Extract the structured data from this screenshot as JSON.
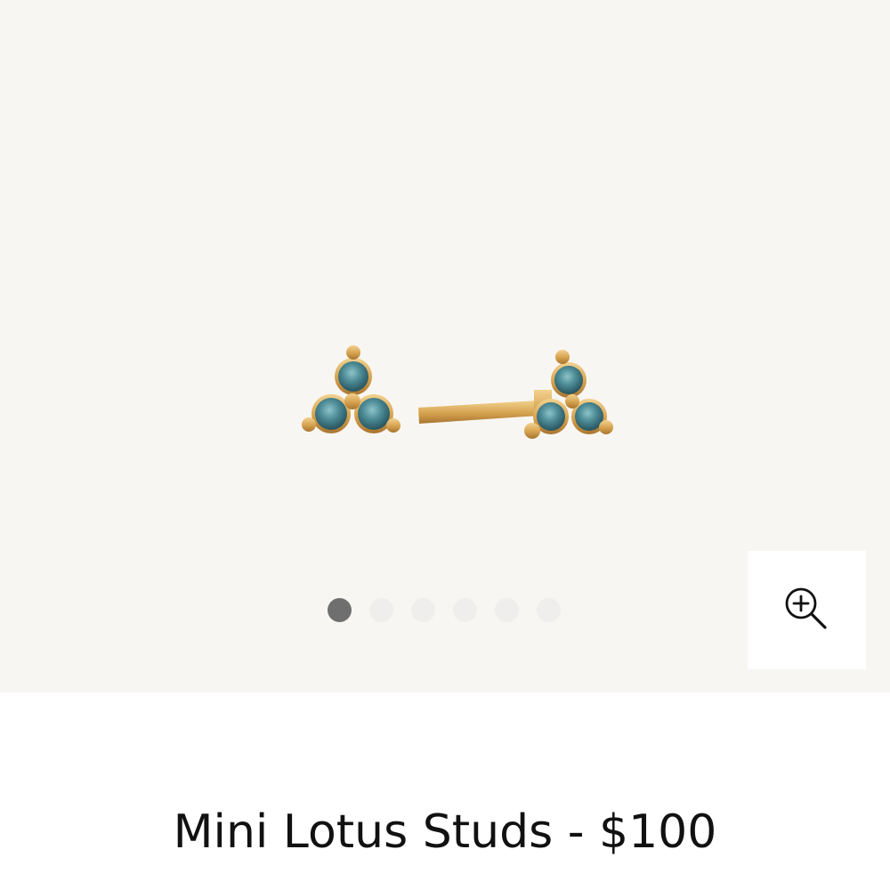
{
  "product": {
    "name": "Mini Lotus Studs",
    "separator": "-",
    "price": "$100",
    "image_alt": "Mini Lotus Studs earrings with blue-green stones on gold setting"
  },
  "gallery": {
    "total_images": 6,
    "active_index": 0,
    "zoom_icon": "zoom-in-icon",
    "background_color": "#f8f6f2"
  },
  "colors": {
    "gold": "#d9a852",
    "stone": "#3f7c87",
    "active_dot": "#6f6f6f",
    "inactive_dot": "#efeeec"
  }
}
